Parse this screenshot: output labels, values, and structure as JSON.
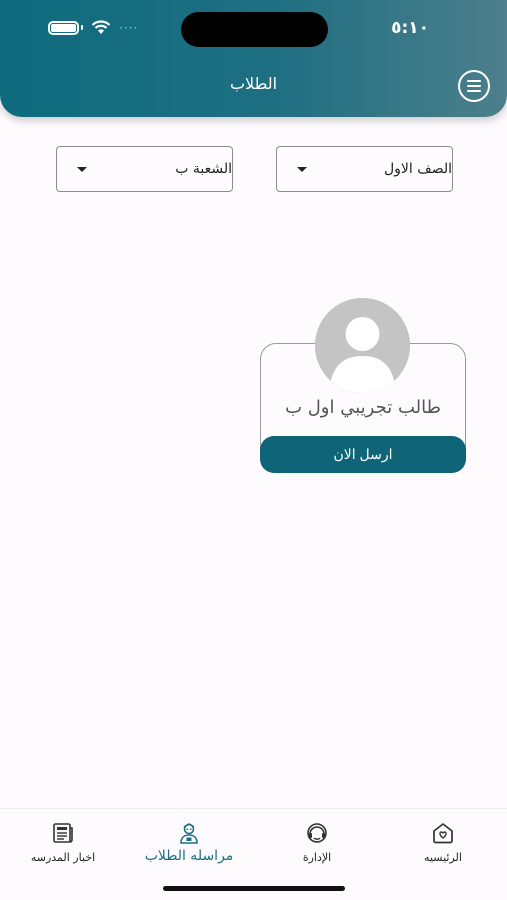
{
  "status_bar": {
    "time": "٥:١٠",
    "dots": "····"
  },
  "header": {
    "title": "الطلاب"
  },
  "filters": {
    "class_value": "الصف الاول",
    "section_value": "الشعبة ب"
  },
  "student_card": {
    "name": "طالب تجريبي اول ب",
    "send_label": "ارسل الان"
  },
  "bottom_nav": {
    "items": [
      {
        "label": "اخبار المدرسه",
        "icon": "newspaper-icon"
      },
      {
        "label": "مراسله الطلاب",
        "icon": "student-icon",
        "active": true
      },
      {
        "label": "الإدارة",
        "icon": "headset-icon"
      },
      {
        "label": "الرئيسيه",
        "icon": "home-icon"
      }
    ]
  },
  "colors": {
    "header_start": "#0e6b7e",
    "header_end": "#4d7f8c",
    "button": "#0f6478",
    "active_nav": "#1c6f83"
  }
}
